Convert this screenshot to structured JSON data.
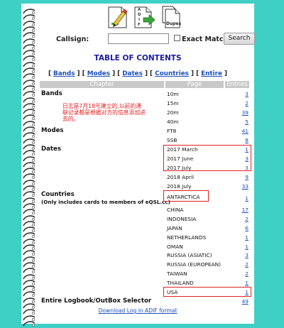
{
  "toolbar": {
    "adif_letters": [
      "A",
      "D",
      "I",
      "F"
    ],
    "dupes_label": "Dupes"
  },
  "search": {
    "callsign_label": "Callsign:",
    "callsign_value": "",
    "exact_match_label": "Exact Match",
    "exact_match_checked": false,
    "search_button": "Search"
  },
  "toc": {
    "title": "TABLE OF CONTENTS",
    "links": [
      "Bands",
      "Modes",
      "Dates",
      "Countries",
      "Entire"
    ],
    "columns": [
      "Chapter",
      "Page",
      "Entries"
    ]
  },
  "note": "日志是7月18号建立的,以前的通联记录都是根据对方的信息添加进去的。",
  "sections": {
    "bands": {
      "label": "Bands",
      "items": [
        {
          "page": "10m",
          "entries": "3"
        },
        {
          "page": "15m",
          "entries": "2"
        },
        {
          "page": "20m",
          "entries": "39"
        },
        {
          "page": "40m",
          "entries": "5"
        }
      ]
    },
    "modes": {
      "label": "Modes",
      "items": [
        {
          "page": "FT8",
          "entries": "41"
        },
        {
          "page": "SSB",
          "entries": "8"
        }
      ]
    },
    "dates": {
      "label": "Dates",
      "items": [
        {
          "page": "2017 March",
          "entries": "1"
        },
        {
          "page": "2017 June",
          "entries": "3"
        },
        {
          "page": "2017 July",
          "entries": "3"
        },
        {
          "page": "2018 April",
          "entries": "9"
        },
        {
          "page": "2018 July",
          "entries": "33"
        }
      ]
    },
    "countries": {
      "label": "Countries",
      "sub": "(Only includes cards to members of eQSL.cc)",
      "items": [
        {
          "page": "ANTARCTICA",
          "entries": "1"
        },
        {
          "page": "CHINA",
          "entries": "17"
        },
        {
          "page": "INDONESIA",
          "entries": "2"
        },
        {
          "page": "JAPAN",
          "entries": "6"
        },
        {
          "page": "NETHERLANDS",
          "entries": "1"
        },
        {
          "page": "OMAN",
          "entries": "1"
        },
        {
          "page": "RUSSIA (ASIATIC)",
          "entries": "3"
        },
        {
          "page": "RUSSIA (EUROPEAN)",
          "entries": "2"
        },
        {
          "page": "TAIWAN",
          "entries": "2"
        },
        {
          "page": "THAILAND",
          "entries": "1"
        },
        {
          "page": "USA",
          "entries": "1"
        }
      ]
    },
    "entire": {
      "label": "Entire Logbook/OutBox Selector",
      "entries": "49"
    }
  },
  "footer": {
    "download_link": "Download Log in ADIF format"
  },
  "colors": {
    "background": "#3ecfc5",
    "link": "#1a4fbb",
    "title": "#1a1aa6",
    "highlight": "#e02020"
  }
}
